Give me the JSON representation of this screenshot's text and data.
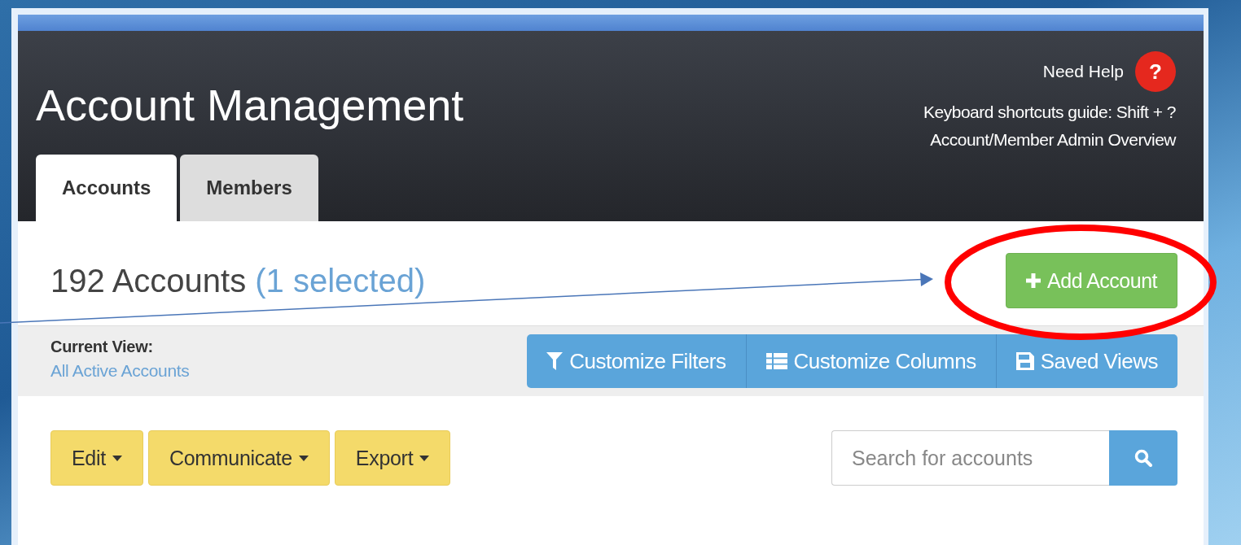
{
  "header": {
    "title": "Account Management",
    "help_label": "Need Help",
    "help_icon": "?",
    "shortcuts": "Keyboard shortcuts guide: Shift + ?",
    "overview_link": "Account/Member Admin Overview"
  },
  "tabs": [
    {
      "label": "Accounts",
      "selected": true
    },
    {
      "label": "Members",
      "selected": false
    }
  ],
  "summary": {
    "count": "192 Accounts",
    "selection": "(1 selected)"
  },
  "add_button": {
    "label": "Add Account"
  },
  "view": {
    "label": "Current View:",
    "name": "All Active Accounts"
  },
  "view_buttons": [
    {
      "kind": "filter",
      "label": "Customize Filters"
    },
    {
      "kind": "columns",
      "label": "Customize Columns"
    },
    {
      "kind": "save",
      "label": "Saved Views"
    }
  ],
  "actions": [
    "Edit",
    "Communicate",
    "Export"
  ],
  "search": {
    "placeholder": "Search for accounts"
  }
}
